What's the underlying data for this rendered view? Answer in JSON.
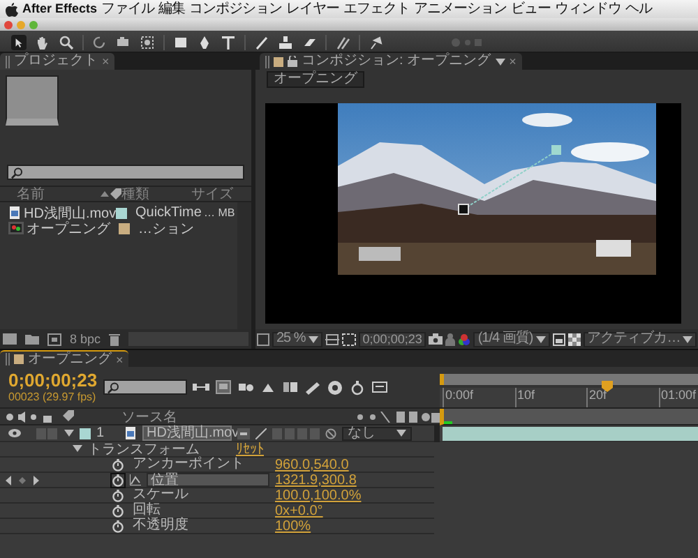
{
  "menu_bar": {
    "app_name": "After Effects",
    "items": [
      "ファイル",
      "編集",
      "コンポジション",
      "レイヤー",
      "エフェクト",
      "アニメーション",
      "ビュー",
      "ウィンドウ",
      "ヘル"
    ]
  },
  "project_panel": {
    "tab": "プロジェクト",
    "close": "×",
    "columns": [
      "名前",
      "種類",
      "サイズ"
    ],
    "items": [
      {
        "name": "HD浅間山.mov",
        "kind": "footage",
        "color": "#a9d6d2",
        "type": "QuickTime",
        "size": "… MB"
      },
      {
        "name": "オープニング",
        "kind": "composition",
        "color": "#c9ad80",
        "type": "…ション"
      }
    ],
    "bit_depth": "8 bpc"
  },
  "composition_panel": {
    "tab": "コンポジション: オープニング",
    "close": "×",
    "breadcrumb": "オープニング",
    "zoom": "25 %",
    "timecode": "0;00;00;23",
    "resolution": "(1/4 画質)",
    "camera": "アクティブカ…"
  },
  "timeline_panel": {
    "tab": "オープニング",
    "close": "×",
    "timecode": "0;00;00;23",
    "frame_info": "00023 (29.97 fps)",
    "source_column": "ソース名",
    "ruler": [
      "0:00f",
      "10f",
      "20f",
      "01:00f"
    ],
    "layer": {
      "number": "1",
      "name": "HD浅間山.mov",
      "color": "#a9d6d2",
      "parent": "なし"
    },
    "transform": {
      "label": "トランスフォーム",
      "reset": "ﾘｾｯﾄ",
      "expanded": true,
      "properties": [
        {
          "name": "アンカーポイント",
          "value": "960.0,540.0",
          "selected": false,
          "keyframed": false
        },
        {
          "name": "位置",
          "value": "1321.9,300.8",
          "selected": true,
          "keyframed": true
        },
        {
          "name": "スケール",
          "value": "100.0,100.0%",
          "selected": false,
          "keyframed": false
        },
        {
          "name": "回転",
          "value": "0x+0.0°",
          "selected": false,
          "keyframed": false
        },
        {
          "name": "不透明度",
          "value": "100%",
          "selected": false,
          "keyframed": false
        }
      ]
    }
  }
}
